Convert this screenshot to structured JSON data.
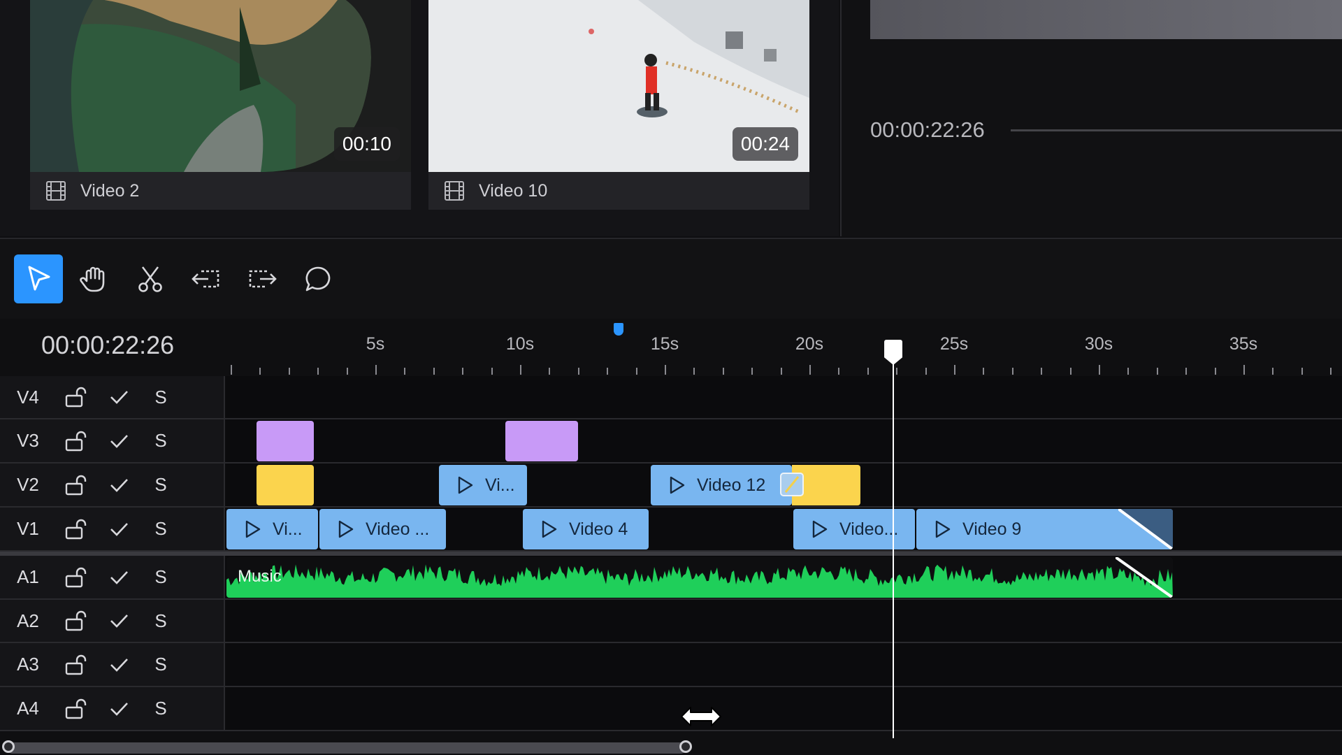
{
  "media_bin": {
    "items": [
      {
        "name": "Video 2",
        "duration": "00:10",
        "icon": "film-icon"
      },
      {
        "name": "Video 10",
        "duration": "00:24",
        "icon": "film-icon"
      }
    ]
  },
  "viewer": {
    "timecode": "00:00:22:26"
  },
  "toolbar": {
    "tools": [
      {
        "name": "select",
        "icon": "pointer-icon",
        "active": true
      },
      {
        "name": "hand",
        "icon": "hand-icon",
        "active": false
      },
      {
        "name": "razor",
        "icon": "scissors-icon",
        "active": false
      },
      {
        "name": "trim-start",
        "icon": "trim-left-icon",
        "active": false
      },
      {
        "name": "trim-end",
        "icon": "trim-right-icon",
        "active": false
      },
      {
        "name": "comment",
        "icon": "comment-icon",
        "active": false
      }
    ]
  },
  "timeline": {
    "timecode": "00:00:22:26",
    "ruler_labels": [
      "5s",
      "10s",
      "15s",
      "20s",
      "25s",
      "30s",
      "35s"
    ],
    "playhead_seconds": 22.9,
    "marker_seconds": 13.4,
    "tracks": [
      {
        "name": "V4",
        "solo": "S"
      },
      {
        "name": "V3",
        "solo": "S"
      },
      {
        "name": "V2",
        "solo": "S"
      },
      {
        "name": "V1",
        "solo": "S"
      },
      {
        "name": "A1",
        "solo": "S"
      },
      {
        "name": "A2",
        "solo": "S"
      },
      {
        "name": "A3",
        "solo": "S"
      },
      {
        "name": "A4",
        "solo": "S"
      }
    ],
    "clips": {
      "v2_a": "Vi...",
      "v2_b": "Video 12",
      "v1_a": "Vi...",
      "v1_b": "Video ...",
      "v1_c": "Video 4",
      "v1_d": "Video...",
      "v1_e": "Video 9",
      "a1": "Music"
    },
    "colors": {
      "video_clip": "#79b6f0",
      "title_clip": "#c89af7",
      "color_clip": "#fbd44d",
      "audio_wave": "#1fcf5a",
      "accent": "#2b95ff"
    }
  }
}
